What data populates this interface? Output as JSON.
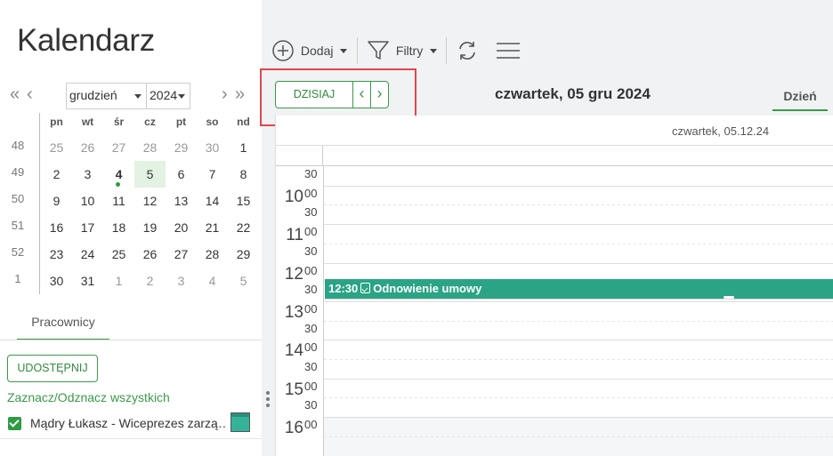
{
  "app": {
    "title": "Kalendarz"
  },
  "mini_calendar": {
    "month": "grudzień",
    "year": "2024",
    "weekday_headers": [
      "pn",
      "wt",
      "śr",
      "cz",
      "pt",
      "so",
      "nd"
    ],
    "weeks": [
      {
        "number": "48",
        "days": [
          "25",
          "26",
          "27",
          "28",
          "29",
          "30",
          "1"
        ]
      },
      {
        "number": "49",
        "days": [
          "2",
          "3",
          "4",
          "5",
          "6",
          "7",
          "8"
        ]
      },
      {
        "number": "50",
        "days": [
          "9",
          "10",
          "11",
          "12",
          "13",
          "14",
          "15"
        ]
      },
      {
        "number": "51",
        "days": [
          "16",
          "17",
          "18",
          "19",
          "20",
          "21",
          "22"
        ]
      },
      {
        "number": "52",
        "days": [
          "23",
          "24",
          "25",
          "26",
          "27",
          "28",
          "29"
        ]
      },
      {
        "number": "1",
        "days": [
          "30",
          "31",
          "1",
          "2",
          "3",
          "4",
          "5"
        ]
      }
    ],
    "today": "4",
    "selected": "5"
  },
  "sidebar": {
    "tab_label": "Pracownicy",
    "share_button": "UDOSTĘPNIJ",
    "select_all": "Zaznacz/Odznacz wszystkich",
    "employees": [
      {
        "name": "Mądry Łukasz - Wiceprezes zarzą…",
        "checked": true,
        "color": "#35b39a"
      }
    ]
  },
  "toolbar": {
    "add_label": "Dodaj",
    "filters_label": "Filtry"
  },
  "navigation": {
    "today_button": "DZISIAJ",
    "date_title": "czwartek, 05 gru 2024",
    "view_tab": "Dzień"
  },
  "day_view": {
    "column_header": "czwartek, 05.12.24",
    "hours": [
      "10",
      "11",
      "12",
      "13",
      "14",
      "15",
      "16"
    ],
    "minute_labels": {
      "zero": "00",
      "half": "30"
    }
  },
  "event": {
    "time": "12:30",
    "title": "Odnowienie umowy",
    "color": "#2aa484"
  },
  "colors": {
    "accent": "#3a9a48",
    "highlight": "#e0474c"
  }
}
